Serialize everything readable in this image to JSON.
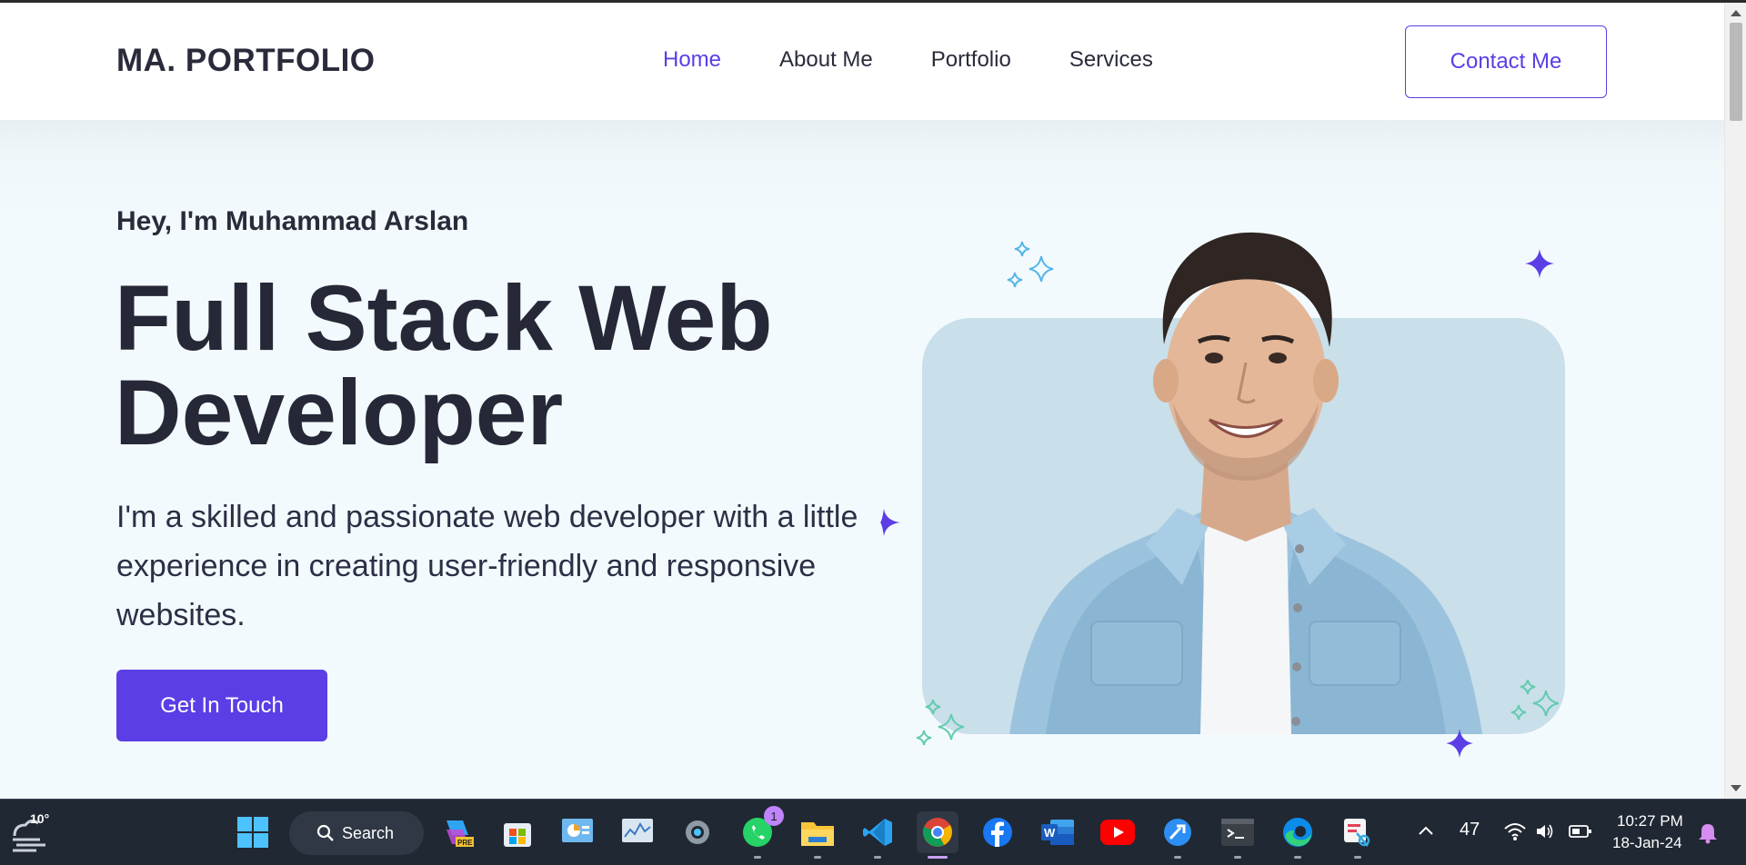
{
  "navbar": {
    "brand": "MA. PORTFOLIO",
    "links": [
      "Home",
      "About Me",
      "Portfolio",
      "Services"
    ],
    "active_link": "Home",
    "contact_button": "Contact Me"
  },
  "hero": {
    "greeting": "Hey, I'm Muhammad Arslan",
    "headline_line1": "Full Stack Web",
    "headline_line2": "Developer",
    "description": "I'm a skilled and passionate web developer with a little experience in creating user-friendly and responsive websites.",
    "cta_button": "Get In Touch"
  },
  "taskbar": {
    "weather_temp": "10°",
    "search_label": "Search",
    "whatsapp_badge": "1",
    "tray_count": "47",
    "time": "10:27 PM",
    "date": "18-Jan-24",
    "pinned_icons": [
      "windows-start",
      "search",
      "copilot",
      "microsoft-store",
      "control-panel",
      "resource-monitor",
      "settings",
      "whatsapp",
      "file-explorer",
      "vscode",
      "chrome",
      "facebook",
      "word",
      "youtube",
      "feedback-hub",
      "terminal",
      "edge",
      "snipping-tool"
    ]
  },
  "colors": {
    "accent": "#5b3ee6",
    "text_dark": "#262838",
    "hero_bg": "#f3fafd",
    "photo_card": "#c9dfea",
    "taskbar": "#202833"
  }
}
